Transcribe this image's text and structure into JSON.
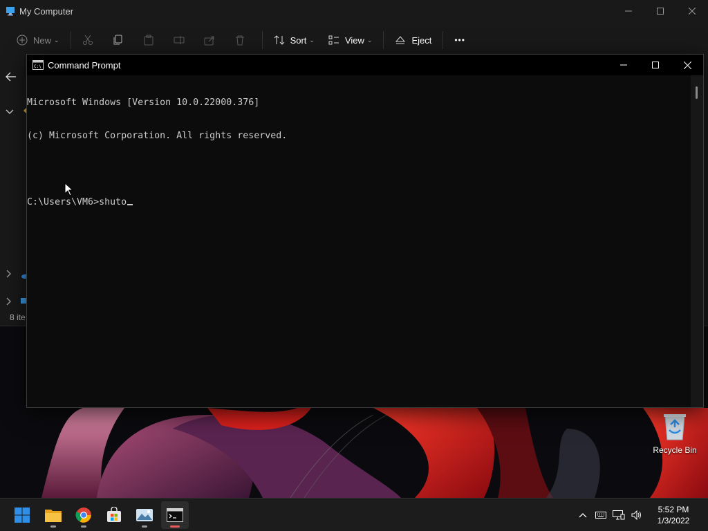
{
  "explorer": {
    "title": "My Computer",
    "toolbar": {
      "new_label": "New",
      "sort_label": "Sort",
      "view_label": "View",
      "eject_label": "Eject",
      "more_label": "•••"
    },
    "status_text": "8 ite"
  },
  "cmd": {
    "title": "Command Prompt",
    "lines": [
      "Microsoft Windows [Version 10.0.22000.376]",
      "(c) Microsoft Corporation. All rights reserved.",
      "",
      "C:\\Users\\VM6>shuto"
    ]
  },
  "desktop": {
    "recycle_bin_label": "Recycle Bin"
  },
  "taskbar": {
    "apps": [
      "start-icon",
      "file-explorer-icon",
      "chrome-icon",
      "store-icon",
      "photos-icon",
      "command-prompt-icon"
    ],
    "time": "5:52 PM",
    "date": "1/3/2022"
  },
  "colors": {
    "console_bg": "#0c0c0c",
    "console_text": "#cccccc",
    "taskbar_bg": "#1c1c1c",
    "active_indicator": "#e85b5b",
    "windows_blue": "#2f8fe6"
  }
}
